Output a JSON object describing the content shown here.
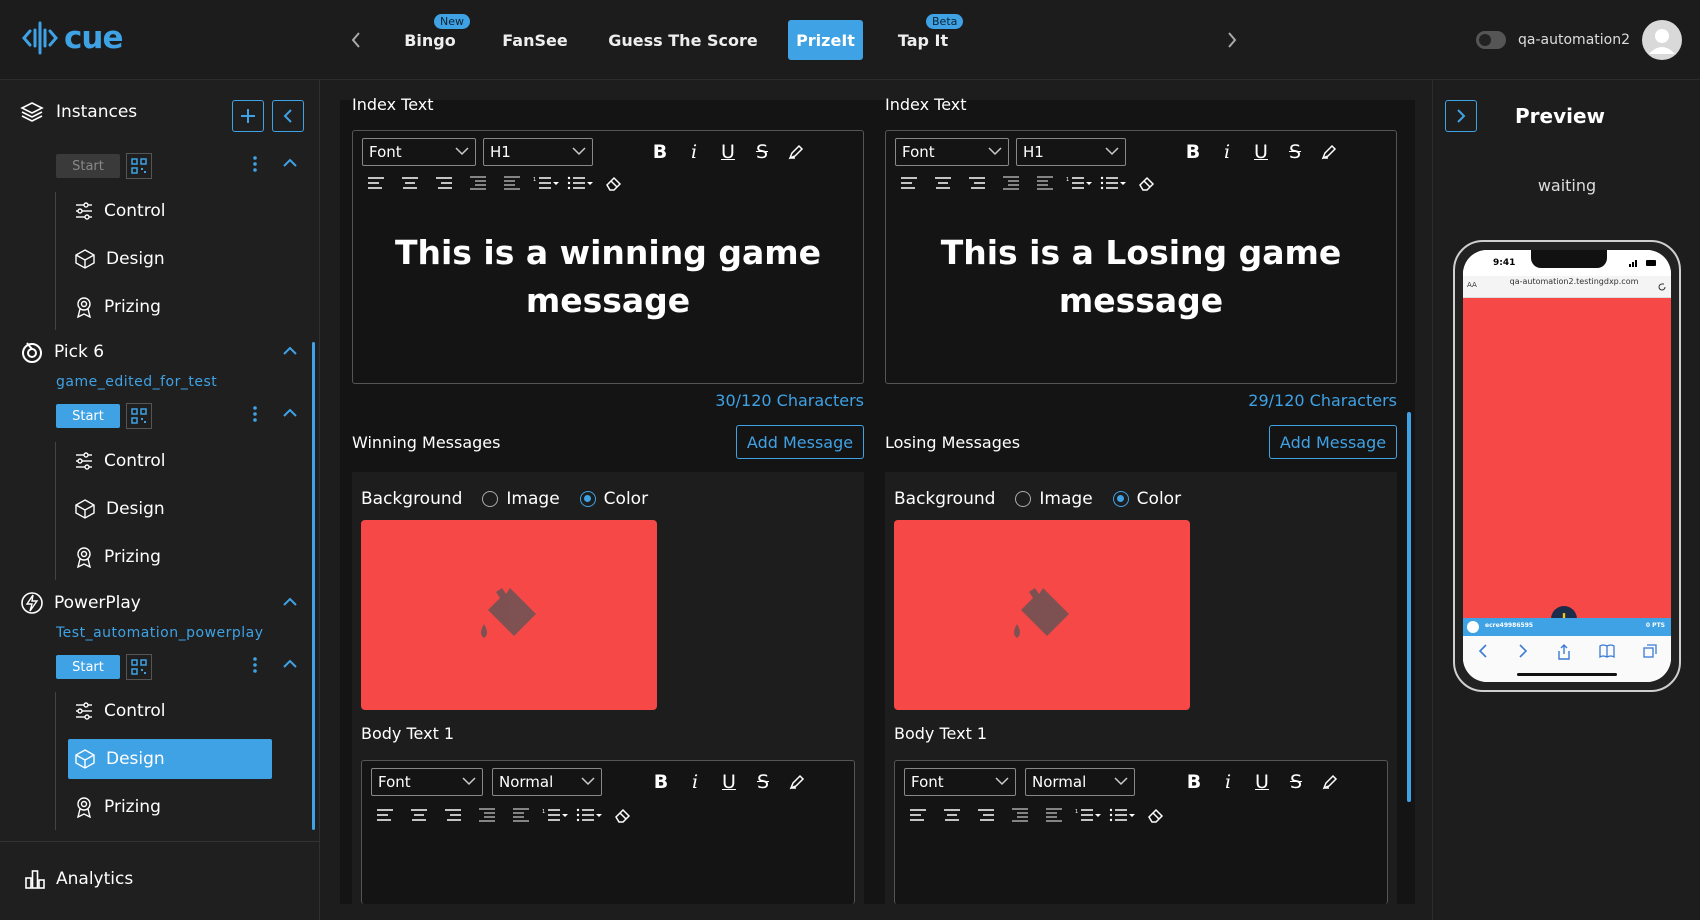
{
  "app": {
    "logo_text": "cue"
  },
  "tabs": [
    {
      "label": "Bingo",
      "tag": "New"
    },
    {
      "label": "FanSee"
    },
    {
      "label": "Guess The Score"
    },
    {
      "label": "PrizeIt",
      "active": true
    },
    {
      "label": "Tap It",
      "tag": "Beta"
    }
  ],
  "user": {
    "name": "qa-automation2"
  },
  "sidebar": {
    "header": "Instances",
    "start_label": "Start",
    "menu_items": [
      "Control",
      "Design",
      "Prizing"
    ],
    "games": [
      {
        "title": "Pick 6",
        "instance": "game_edited_for_test"
      },
      {
        "title": "PowerPlay",
        "instance": "Test_automation_powerplay"
      }
    ],
    "analytics": "Analytics",
    "active_item": "Design"
  },
  "toolbar": {
    "font": "Font",
    "heading": "H1",
    "normal": "Normal"
  },
  "winning": {
    "index_label": "Index Text",
    "index_text": "This is a winning game message",
    "chars": "30/120 Characters",
    "messages_label": "Winning Messages",
    "add_label": "Add Message",
    "bg_label": "Background",
    "image_label": "Image",
    "color_label": "Color",
    "color": "#f74848",
    "body_label": "Body Text 1"
  },
  "losing": {
    "index_label": "Index Text",
    "index_text": "This is a Losing game message",
    "chars": "29/120 Characters",
    "messages_label": "Losing Messages",
    "add_label": "Add Message",
    "bg_label": "Background",
    "image_label": "Image",
    "color_label": "Color",
    "color": "#f74848",
    "body_label": "Body Text 1"
  },
  "preview": {
    "title": "Preview",
    "status": "waiting",
    "time": "9:41",
    "url": "qa-automation2.testingdxp.com",
    "aa": "AA",
    "user_id": "ecre49986595",
    "pts": "0 PTS"
  },
  "colors": {
    "accent": "#3fa2e5",
    "swatch": "#f74848"
  }
}
